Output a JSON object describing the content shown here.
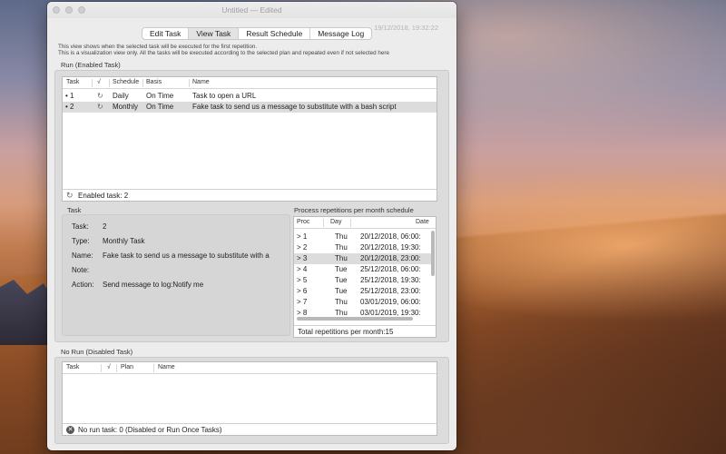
{
  "window": {
    "title": "Untitled — Edited",
    "timestamp": "19/12/2018, 19:32:22"
  },
  "tabs": [
    {
      "label": "Edit Task"
    },
    {
      "label": "View Task",
      "selected": true
    },
    {
      "label": "Result Schedule"
    },
    {
      "label": "Message Log"
    }
  ],
  "notes": {
    "line1": "This view shows when the selected task will be executed for the first repetition.",
    "line2": "This is a visualization view only. All the tasks will be executed according to the selected plan and repeated even if not selected here"
  },
  "run_section": {
    "label": "Run (Enabled Task)",
    "columns": [
      "Task",
      "√",
      "Schedule",
      "Basis",
      "Name"
    ],
    "rows": [
      {
        "task": "• 1",
        "check": "↻",
        "schedule": "Daily",
        "basis": "On Time",
        "name": "Task to open a URL",
        "selected": false
      },
      {
        "task": "• 2",
        "check": "↻",
        "schedule": "Monthly",
        "basis": "On Time",
        "name": "Fake task to send us a message to substitute with a bash script",
        "selected": true
      }
    ],
    "status": "Enabled task: 2"
  },
  "task_section": {
    "label": "Task",
    "details": [
      {
        "key": "Task:",
        "value": "2"
      },
      {
        "key": "Type:",
        "value": "Monthly Task"
      },
      {
        "key": "Name:",
        "value": "Fake task to send us a message to substitute with a"
      },
      {
        "key": "Note:",
        "value": ""
      },
      {
        "key": "Action:",
        "value": "Send message to log:Notify me"
      }
    ]
  },
  "schedule_section": {
    "label": "Process repetitions per month schedule",
    "columns": [
      "Proc",
      "Day",
      "Date"
    ],
    "rows": [
      {
        "proc": "> 1",
        "day": "Thu",
        "date": "20/12/2018, 06:00:",
        "selected": false
      },
      {
        "proc": "> 2",
        "day": "Thu",
        "date": "20/12/2018, 19:30:",
        "selected": false
      },
      {
        "proc": "> 3",
        "day": "Thu",
        "date": "20/12/2018, 23:00:",
        "selected": true
      },
      {
        "proc": "> 4",
        "day": "Tue",
        "date": "25/12/2018, 06:00:",
        "selected": false
      },
      {
        "proc": "> 5",
        "day": "Tue",
        "date": "25/12/2018, 19:30:",
        "selected": false
      },
      {
        "proc": "> 6",
        "day": "Tue",
        "date": "25/12/2018, 23:00:",
        "selected": false
      },
      {
        "proc": "> 7",
        "day": "Thu",
        "date": "03/01/2019, 06:00:",
        "selected": false
      },
      {
        "proc": "> 8",
        "day": "Thu",
        "date": "03/01/2019, 19:30:",
        "selected": false
      }
    ],
    "total": "Total repetitions per month:15"
  },
  "norun_section": {
    "label": "No Run (Disabled Task)",
    "columns": [
      "Task",
      "√",
      "Plan",
      "Name"
    ],
    "status": "No run task: 0 (Disabled or Run Once Tasks)"
  },
  "colors": {
    "window_bg": "#ececec",
    "selection": "#dcdcdc",
    "group_bg": "#dcdcdc"
  }
}
